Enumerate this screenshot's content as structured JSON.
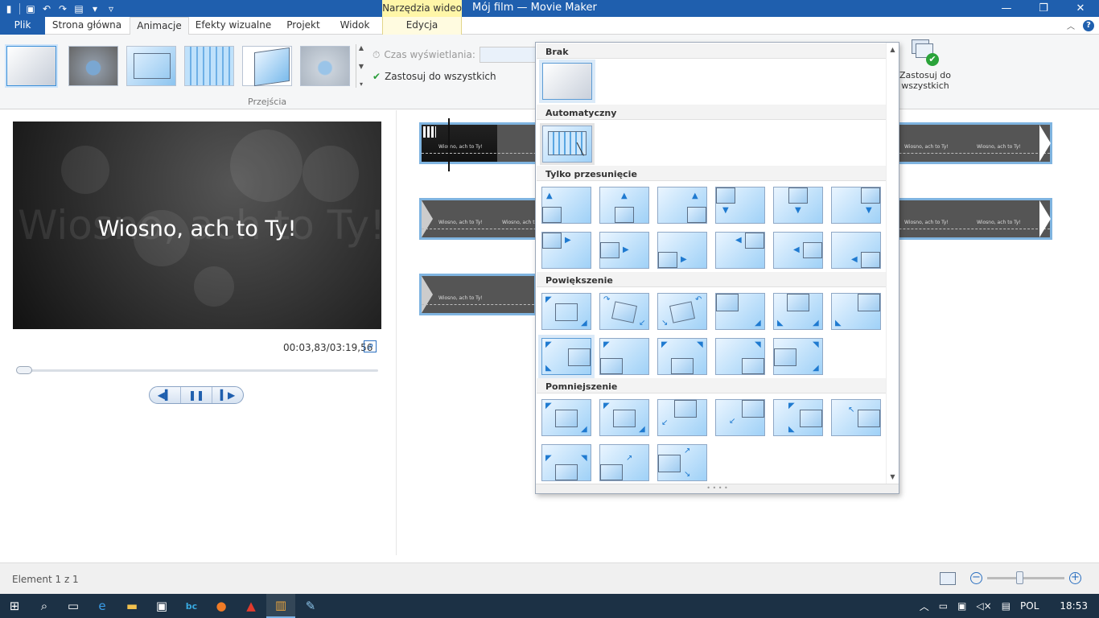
{
  "window": {
    "context_header": "Narzędzia wideo",
    "title": "Mój film — Movie Maker"
  },
  "tabs": {
    "file": "Plik",
    "home": "Strona główna",
    "animations": "Animacje",
    "visual_effects": "Efekty wizualne",
    "project": "Projekt",
    "view": "Widok",
    "edit": "Edycja"
  },
  "ribbon": {
    "transitions_group": "Przejścia",
    "duration_label": "Czas wyświetlania:",
    "apply_all": "Zastosuj do wszystkich",
    "apply_all_big": "Zastosuj do wszystkich"
  },
  "preview": {
    "video_text": "Wiosno, ach to Ty!",
    "video_bg_text": "Wiosno, ach to Ty!",
    "time": "00:03,83/03:19,56"
  },
  "storyboard": {
    "clip_text": "Wiosno, ach to Ty!"
  },
  "gallery": {
    "sections": [
      "Brak",
      "Automatyczny",
      "Tylko przesunięcie",
      "Powiększenie",
      "Pomniejszenie"
    ]
  },
  "status": {
    "element": "Element 1 z 1"
  },
  "taskbar": {
    "lang": "POL",
    "clock": "18:53"
  }
}
